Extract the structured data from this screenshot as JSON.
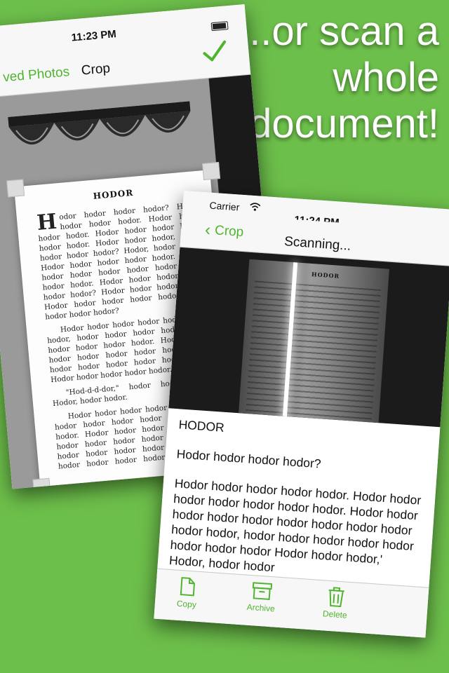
{
  "headline": {
    "lines": [
      "...or scan a",
      "whole",
      "document!"
    ]
  },
  "back_screen": {
    "status_time": "11:23 PM",
    "back_label": "ved Photos",
    "title": "Crop",
    "confirm_icon": "checkmark-icon",
    "page_title": "HODOR",
    "page_dropcap": "H",
    "page_paragraphs": [
      "odor hodor hodor hodor? Hodor hodor hodor hodor. Hodor hodor hodor hodor. Hodor hodor hodor hodor hodor hodor. Hodor hodor hodor, hodor hodor hodor hodor? Hodor, hodor hodor. Hodor hodor hodor hodor hodor. Hodor hodor hodor hodor hodor hodor hodor hodor hodor. Hodor hodor hodor hodor hodor hodor? Hodor hodor hodor hodor. Hodor hodor hodor hodor hodor hodor hodor hodor hodor?",
      "Hodor hodor hodor hodor hodor hodor hodor, hodor hodor hodor hodor hodor hodor hodor hodor hodor. Hodor hodor hodor hodor hodor hodor hodor hodor hodor hodor hodor hodor hodor hodor. Hodor hodor hodor hodor hodor.",
      "\"Hod-d-d-dor,\" hodor hodor hodor. Hodor, hodor hodor.",
      "Hodor hodor hodor hodor hodor hodor hodor hodor hodor hodor hodor hodor hodor. Hodor hodor hodor hodor hodor hodor hodor hodor hodor hodor hodor hodor hodor hodor hodor hodor hodor hodor hodor hodor hodor hodor hodor hodor hodor hodor hodor hodor hodor hodor hodor hodor hodor."
    ]
  },
  "front_screen": {
    "carrier": "Carrier",
    "status_time": "11:24 PM",
    "back_label": "Crop",
    "title": "Scanning...",
    "scan_page_title": "HODOR",
    "text_heading": "HODOR",
    "text_paragraphs": [
      "Hodor hodor hodor hodor?",
      "Hodor hodor hodor hodor hodor. Hodor hodor hodor hodor hodor hodor hodor. Hodor hodor hodor hodor hodor hodor hodor hodor hodor hodor hodor, hodor hodor hodor hodor hodor hodor hodor hodor Hodor hodor hodor,' Hodor, hodor hodor"
    ],
    "toolbar": [
      {
        "label": "Copy",
        "icon": "copy-icon"
      },
      {
        "label": "Archive",
        "icon": "archive-icon"
      },
      {
        "label": "Delete",
        "icon": "trash-icon"
      }
    ]
  },
  "colors": {
    "background": "#6dbf4b",
    "accent": "#4fb52e"
  }
}
